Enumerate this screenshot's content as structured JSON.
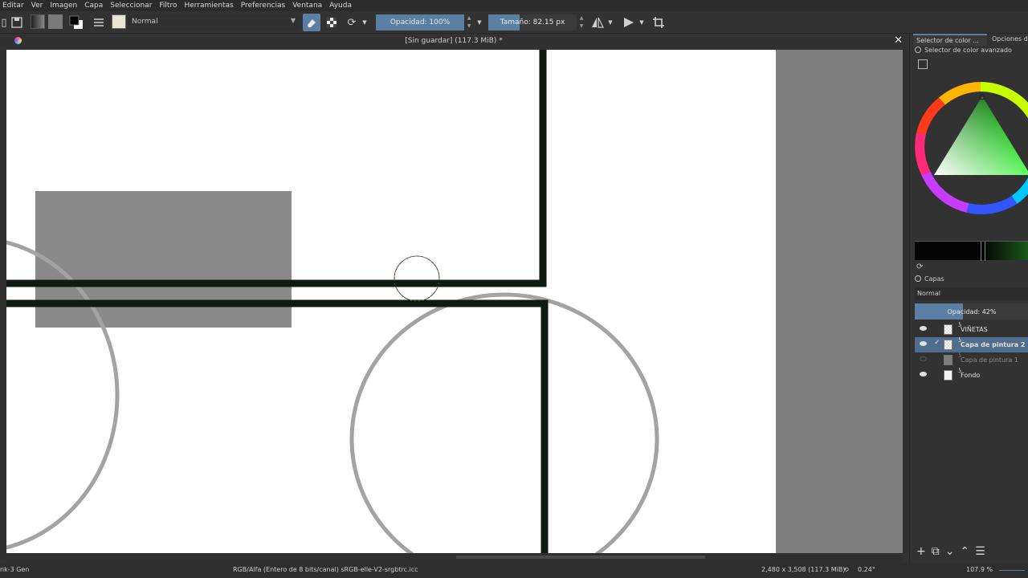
{
  "menu": [
    "Editar",
    "Ver",
    "Imagen",
    "Capa",
    "Seleccionar",
    "Filtro",
    "Herramientas",
    "Preferencias",
    "Ventana",
    "Ayuda"
  ],
  "toolbar": {
    "blend_mode": "Normal",
    "opacity_label": "Opacidad: 100%",
    "opacity_value": 1.0,
    "size_label": "Tamaño: 82.15 px",
    "size_fill": 0.35
  },
  "document": {
    "title": "[Sin guardar]  (117.3 MiB) *",
    "close_glyph": "✕"
  },
  "dock": {
    "tab_selector": "Selector de color ...",
    "tab_options": "Opciones de",
    "advanced_color_title": "Selector de color avanzado",
    "layers_title": "Capas",
    "layers_blend": "Normal",
    "layers_opacity_label": "Opacidad:  42%",
    "layers_opacity_value": 0.42,
    "layers": [
      {
        "name": "VIÑETAS",
        "visible": true,
        "active": false,
        "thumb": "checker"
      },
      {
        "name": "Capa de pintura 2",
        "visible": true,
        "active": true,
        "thumb": "checker"
      },
      {
        "name": "Capa de pintura 1",
        "visible": false,
        "active": false,
        "thumb": "grey"
      },
      {
        "name": "Fondo",
        "visible": true,
        "active": false,
        "thumb": "white"
      }
    ]
  },
  "status": {
    "tool": "nk-3 Gen",
    "color_space": "RGB/Alfa (Entero de 8 bits/canal)  sRGB-elle-V2-srgbtrc.icc",
    "dimensions": "2,480 x 3,508 (117.3 MiB)",
    "rotation": "0.24°",
    "zoom": "107.9 %"
  },
  "colors": {
    "accent": "#5a7fa3",
    "ink": "#0f1a12",
    "grey_stroke": "#a3a3a3",
    "grey_rect": "#8a8a8a"
  }
}
